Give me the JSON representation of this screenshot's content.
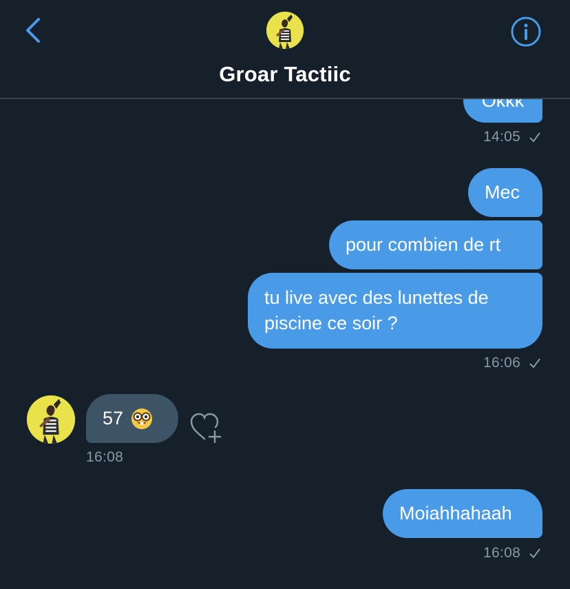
{
  "header": {
    "title": "Groar Tactiic"
  },
  "icons": {
    "back": "chevron-left-icon",
    "info": "info-circle-icon",
    "react": "heart-plus-icon",
    "read": "checkmark-icon",
    "emoji": "nerd-face-emoji"
  },
  "colors": {
    "background": "#15202b",
    "accent": "#4a9be7",
    "incoming_bubble": "#3d5466",
    "timestamp": "#8899a6"
  },
  "messages": [
    {
      "direction": "out",
      "text": "Okkk",
      "time": "14:05"
    },
    {
      "direction": "out",
      "text": "Mec"
    },
    {
      "direction": "out",
      "text": "pour combien de rt"
    },
    {
      "direction": "out",
      "text": "tu live avec des lunettes de piscine ce soir ?",
      "time": "16:06"
    },
    {
      "direction": "in",
      "text": "57",
      "emoji": "🤓",
      "time": "16:08"
    },
    {
      "direction": "out",
      "text": "Moiahhahaah",
      "time": "16:08"
    }
  ]
}
